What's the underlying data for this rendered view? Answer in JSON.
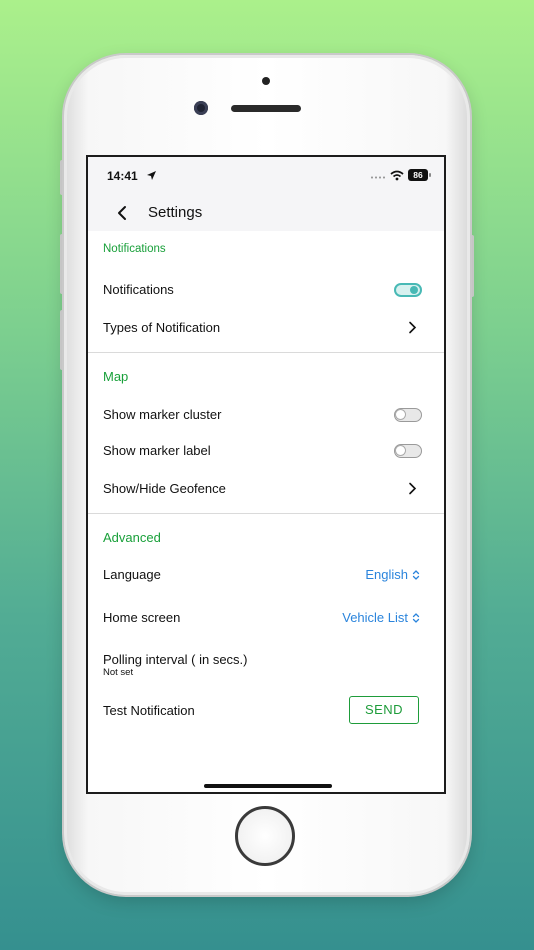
{
  "status_bar": {
    "time": "14:41",
    "battery": "86"
  },
  "header": {
    "title": "Settings"
  },
  "sections": {
    "notifications": {
      "title": "Notifications",
      "notifications_label": "Notifications",
      "notifications_enabled": true,
      "types_label": "Types of Notification"
    },
    "map": {
      "title": "Map",
      "marker_cluster_label": "Show marker cluster",
      "marker_cluster_enabled": false,
      "marker_label_label": "Show marker label",
      "marker_label_enabled": false,
      "geofence_label": "Show/Hide Geofence"
    },
    "advanced": {
      "title": "Advanced",
      "language_label": "Language",
      "language_value": "English",
      "home_screen_label": "Home screen",
      "home_screen_value": "Vehicle List",
      "polling_label": "Polling interval ( in secs.)",
      "polling_value": "Not set",
      "test_notification_label": "Test Notification",
      "send_label": "SEND"
    }
  },
  "colors": {
    "accent_green": "#19a03a",
    "link_blue": "#2a84dc",
    "toggle_teal": "#48b9b5"
  }
}
